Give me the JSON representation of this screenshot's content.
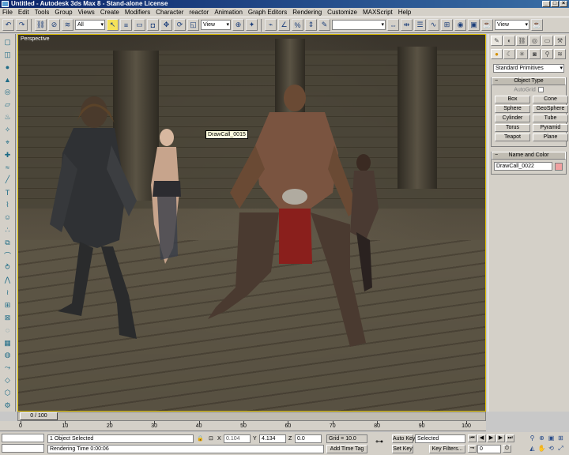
{
  "window": {
    "title": "Untitled  - Autodesk 3ds Max 8  - Stand-alone License",
    "buttons": [
      "_",
      "□",
      "×"
    ]
  },
  "menu": [
    "File",
    "Edit",
    "Tools",
    "Group",
    "Views",
    "Create",
    "Modifiers",
    "Character",
    "reactor",
    "Animation",
    "Graph Editors",
    "Rendering",
    "Customize",
    "MAXScript",
    "Help"
  ],
  "toolbar": {
    "selection_filter": "All",
    "reference_coord": "View",
    "named_selection": "",
    "view_dropdown": "View"
  },
  "viewport": {
    "label": "Perspective",
    "tooltip": "DrawCall_0015",
    "border_color": "#e0c000"
  },
  "command_panel": {
    "category": "Standard Primitives",
    "object_type_title": "Object Type",
    "autogrid": "AutoGrid",
    "primitives": [
      "Box",
      "Cone",
      "Sphere",
      "GeoSphere",
      "Cylinder",
      "Tube",
      "Torus",
      "Pyramid",
      "Teapot",
      "Plane"
    ],
    "name_color_title": "Name and Color",
    "object_name": "DrawCall_0022",
    "object_color": "#f0a0a0"
  },
  "timeline": {
    "frame_display": "0 / 100",
    "ticks": [
      "0",
      "10",
      "20",
      "30",
      "40",
      "50",
      "60",
      "70",
      "80",
      "90",
      "100"
    ]
  },
  "status": {
    "selection": "1 Object Selected",
    "prompt": "Rendering Time  0:00:06",
    "x_label": "X",
    "x_value": "0.104",
    "y_label": "Y",
    "y_value": "4.134",
    "z_label": "Z",
    "z_value": "0.0",
    "grid": "Grid = 10.0",
    "add_time_tag": "Add Time Tag",
    "auto_key": "Auto Key",
    "set_key": "Set Key",
    "key_mode": "Selected",
    "key_filters": "Key Filters...",
    "frame": "0"
  }
}
